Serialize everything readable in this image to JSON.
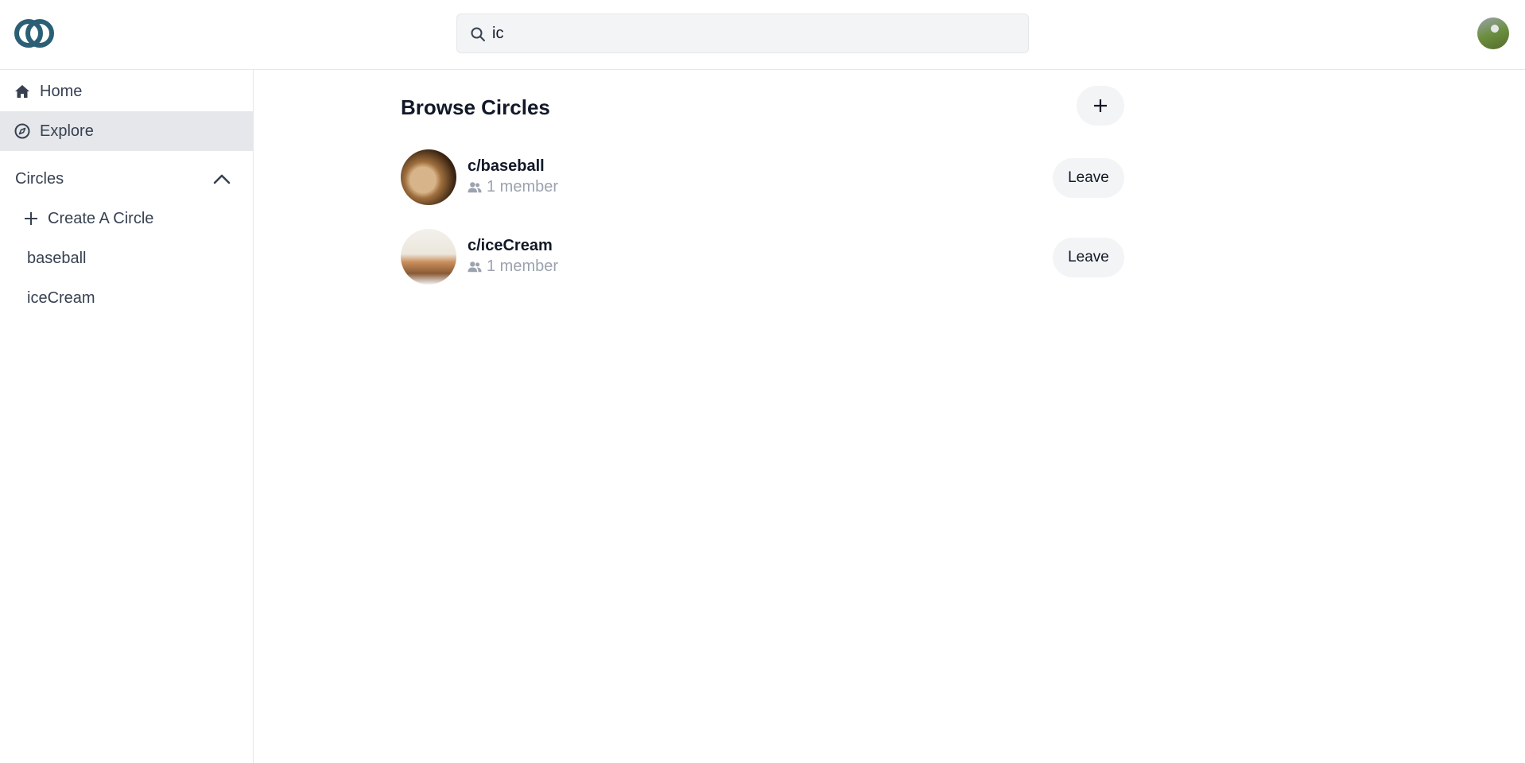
{
  "header": {
    "logo": "circles-logo-icon",
    "search": {
      "value": "ic",
      "placeholder": "",
      "icon": "search-icon"
    },
    "user_avatar": "user-avatar"
  },
  "sidebar": {
    "nav": [
      {
        "label": "Home",
        "icon": "home-icon",
        "active": false
      },
      {
        "label": "Explore",
        "icon": "compass-icon",
        "active": true
      }
    ],
    "circles_section": {
      "label": "Circles",
      "expanded": true,
      "create_label": "Create A Circle",
      "items": [
        {
          "label": "baseball"
        },
        {
          "label": "iceCream"
        }
      ]
    }
  },
  "main": {
    "title": "Browse Circles",
    "circles": [
      {
        "name": "c/baseball",
        "members": "1 member",
        "action": "Leave"
      },
      {
        "name": "c/iceCream",
        "members": "1 member",
        "action": "Leave"
      }
    ]
  },
  "colors": {
    "logo": "#2b5f76",
    "active_nav": "#e5e7eb",
    "button_bg": "#f3f4f6",
    "muted_text": "#9ca3af"
  }
}
